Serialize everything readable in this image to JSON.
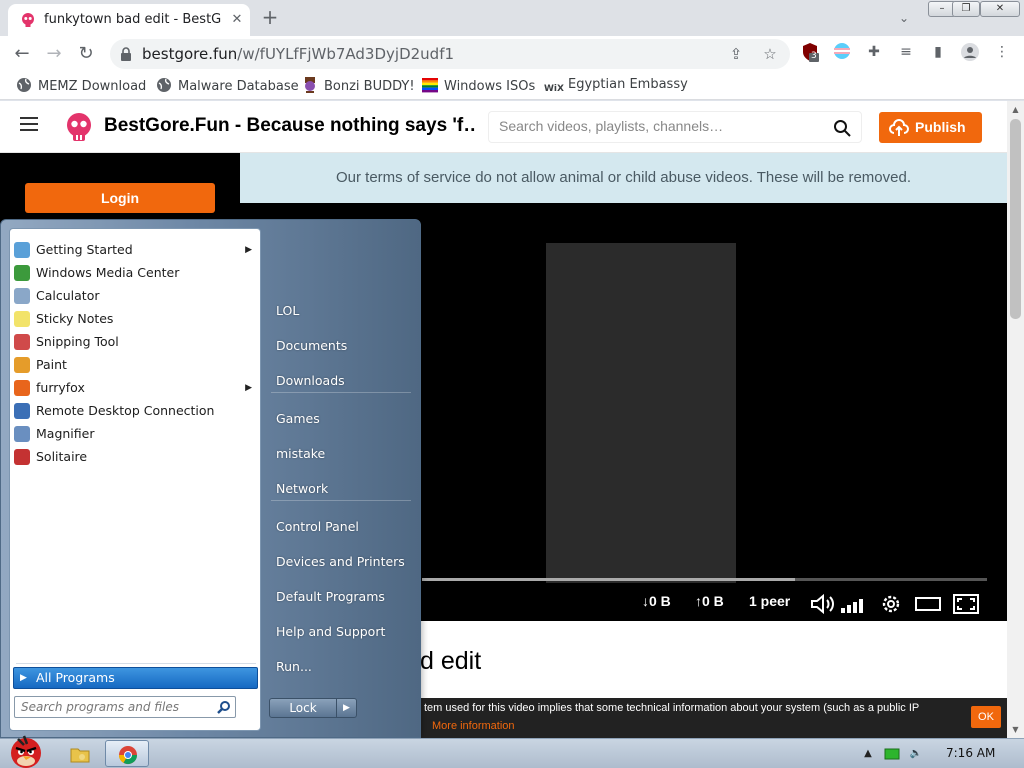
{
  "browser": {
    "tab_title": "funkytown bad edit - BestGore.Fun",
    "tab_close": "✕",
    "new_tab": "+",
    "tab_search": "⌄",
    "window_controls": {
      "minimize": "–",
      "restore": "❐",
      "close": "✕"
    },
    "url_host": "bestgore.fun",
    "url_path": "/w/fUYLfFjWb7Ad3DyjD2udf1",
    "extension_badge": "3",
    "bookmarks": [
      "MEMZ Download",
      "Malware Database",
      "Bonzi BUDDY!",
      "Windows ISOs",
      "Egyptian Embassy"
    ],
    "bookmark_wix_text": "WiX"
  },
  "site": {
    "title": "BestGore.Fun - Because nothing says 'f…",
    "search_placeholder": "Search videos, playlists, channels…",
    "publish_label": "Publish",
    "login_label": "Login",
    "tos_banner": "Our terms of service do not allow animal or child abuse videos. These will be removed.",
    "video_title_partial": "d edit",
    "player": {
      "download": "0 B",
      "upload": "0 B",
      "peers": "1 peer",
      "down_arrow": "↓",
      "up_arrow": "↑",
      "buffered_fraction": 0.66
    },
    "cookie_text": "tem used for this video implies that some technical information about your system (such as a public IP",
    "cookie_more": "More information",
    "cookie_ok": "OK"
  },
  "start_menu": {
    "programs": [
      {
        "label": "Getting Started",
        "icon": "getting-started-icon",
        "submenu": true
      },
      {
        "label": "Windows Media Center",
        "icon": "media-center-icon",
        "submenu": false
      },
      {
        "label": "Calculator",
        "icon": "calculator-icon",
        "submenu": false
      },
      {
        "label": "Sticky Notes",
        "icon": "sticky-notes-icon",
        "submenu": false
      },
      {
        "label": "Snipping Tool",
        "icon": "snipping-tool-icon",
        "submenu": false
      },
      {
        "label": "Paint",
        "icon": "paint-icon",
        "submenu": false
      },
      {
        "label": "furryfox",
        "icon": "firefox-icon",
        "submenu": true
      },
      {
        "label": "Remote Desktop Connection",
        "icon": "remote-desktop-icon",
        "submenu": false
      },
      {
        "label": "Magnifier",
        "icon": "magnifier-icon",
        "submenu": false
      },
      {
        "label": "Solitaire",
        "icon": "solitaire-icon",
        "submenu": false
      }
    ],
    "all_programs": "All Programs",
    "search_placeholder": "Search programs and files",
    "places": [
      "LOL",
      "Documents",
      "Downloads",
      "Games",
      "mistake",
      "Network",
      "Control Panel",
      "Devices and Printers",
      "Default Programs",
      "Help and Support",
      "Run..."
    ],
    "lock_label": "Lock",
    "arrow": "▶"
  },
  "taskbar": {
    "clock": "7:16 AM",
    "tray_show_hidden": "▲"
  },
  "colors": {
    "accent_orange": "#f1680d",
    "tos_banner_bg": "#d4e8ef",
    "start_menu_blue": "#6e88a6"
  }
}
